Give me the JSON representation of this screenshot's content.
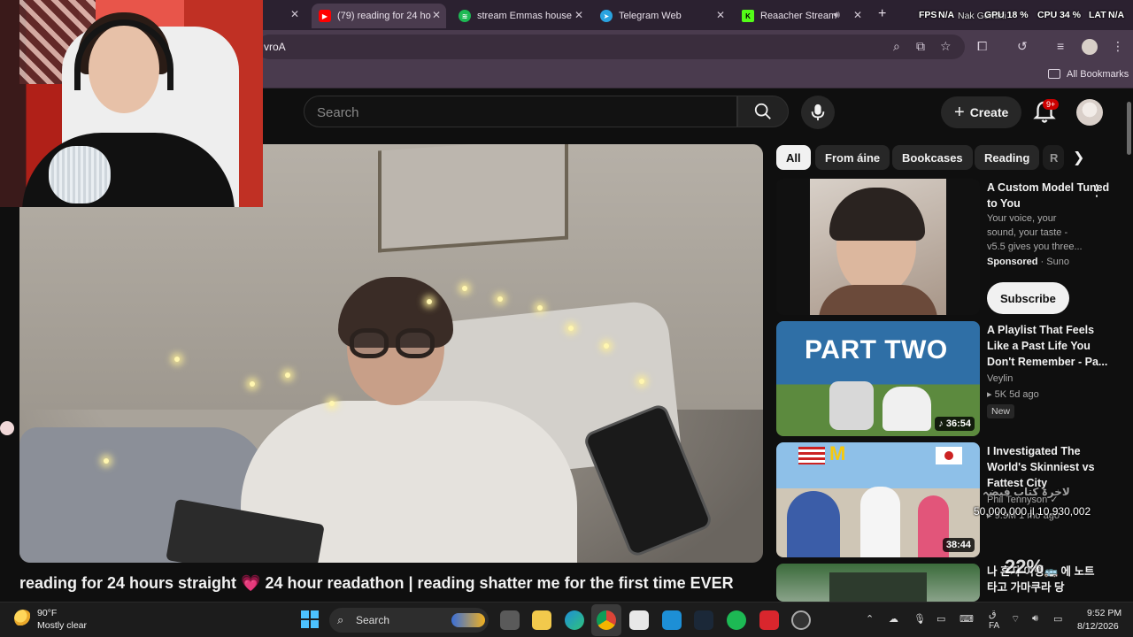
{
  "browser": {
    "tabs": [
      {
        "title": "(79) reading for 24 ho",
        "favicon": "youtube-icon",
        "active": true
      },
      {
        "title": "stream Emmas house",
        "favicon": "spotify-icon",
        "active": false
      },
      {
        "title": "Telegram Web",
        "favicon": "telegram-icon",
        "active": false
      },
      {
        "title": "Reaacher Stream",
        "favicon": "kick-icon",
        "active": false
      }
    ],
    "url_fragment": "vroA",
    "all_bookmarks_label": "All Bookmarks"
  },
  "stream_overlay": {
    "fps": "FPS",
    "fps_value": "N/A",
    "gpu": "GPU 18 %",
    "cpu": "CPU 34 %",
    "lat": "LAT",
    "lat_value": "N/A",
    "name": "Nak Gemini"
  },
  "youtube": {
    "search_placeholder": "Search",
    "create_label": "Create",
    "notification_count": "9+",
    "video_title": "reading for 24 hours straight 💗 24 hour readathon | reading shatter me for the first time EVER",
    "chips": [
      "All",
      "From áine",
      "Bookcases",
      "Reading",
      "R"
    ],
    "sidebar": [
      {
        "title": "A Custom Model Tuned to You",
        "desc": "Your voice, your sound, your taste - v5.5 gives you three...",
        "sponsored": "Sponsored",
        "advertiser": "Suno",
        "button": "Subscribe"
      },
      {
        "title": "A Playlist That Feels Like a Past Life You Don't Remember - Pa...",
        "channel": "Veylin",
        "meta": "5K  5d ago",
        "badge": "New",
        "duration": "36:54",
        "thumb_text": "PART TWO"
      },
      {
        "title": "I Investigated The World's Skinniest vs Fattest City",
        "channel": "Phil Tennyson",
        "meta": "9.9M  1 mo ago",
        "duration": "38:44"
      },
      {
        "title": "나 혼자 여행🚌 에 노트 타고 가마쿠라 당",
        "channel": "",
        "meta": ""
      }
    ],
    "overlay_counter": "50,000,000 jl 10,930,002",
    "overlay_percent": "22%",
    "overlay_arabic": "لاخرۃ کتاب فیضہ"
  },
  "taskbar": {
    "weather_temp": "90°F",
    "weather_desc": "Mostly clear",
    "search_label": "Search",
    "lang1": "ق",
    "lang2": "FA",
    "time": "9:52 PM",
    "date": "8/12/2026"
  }
}
